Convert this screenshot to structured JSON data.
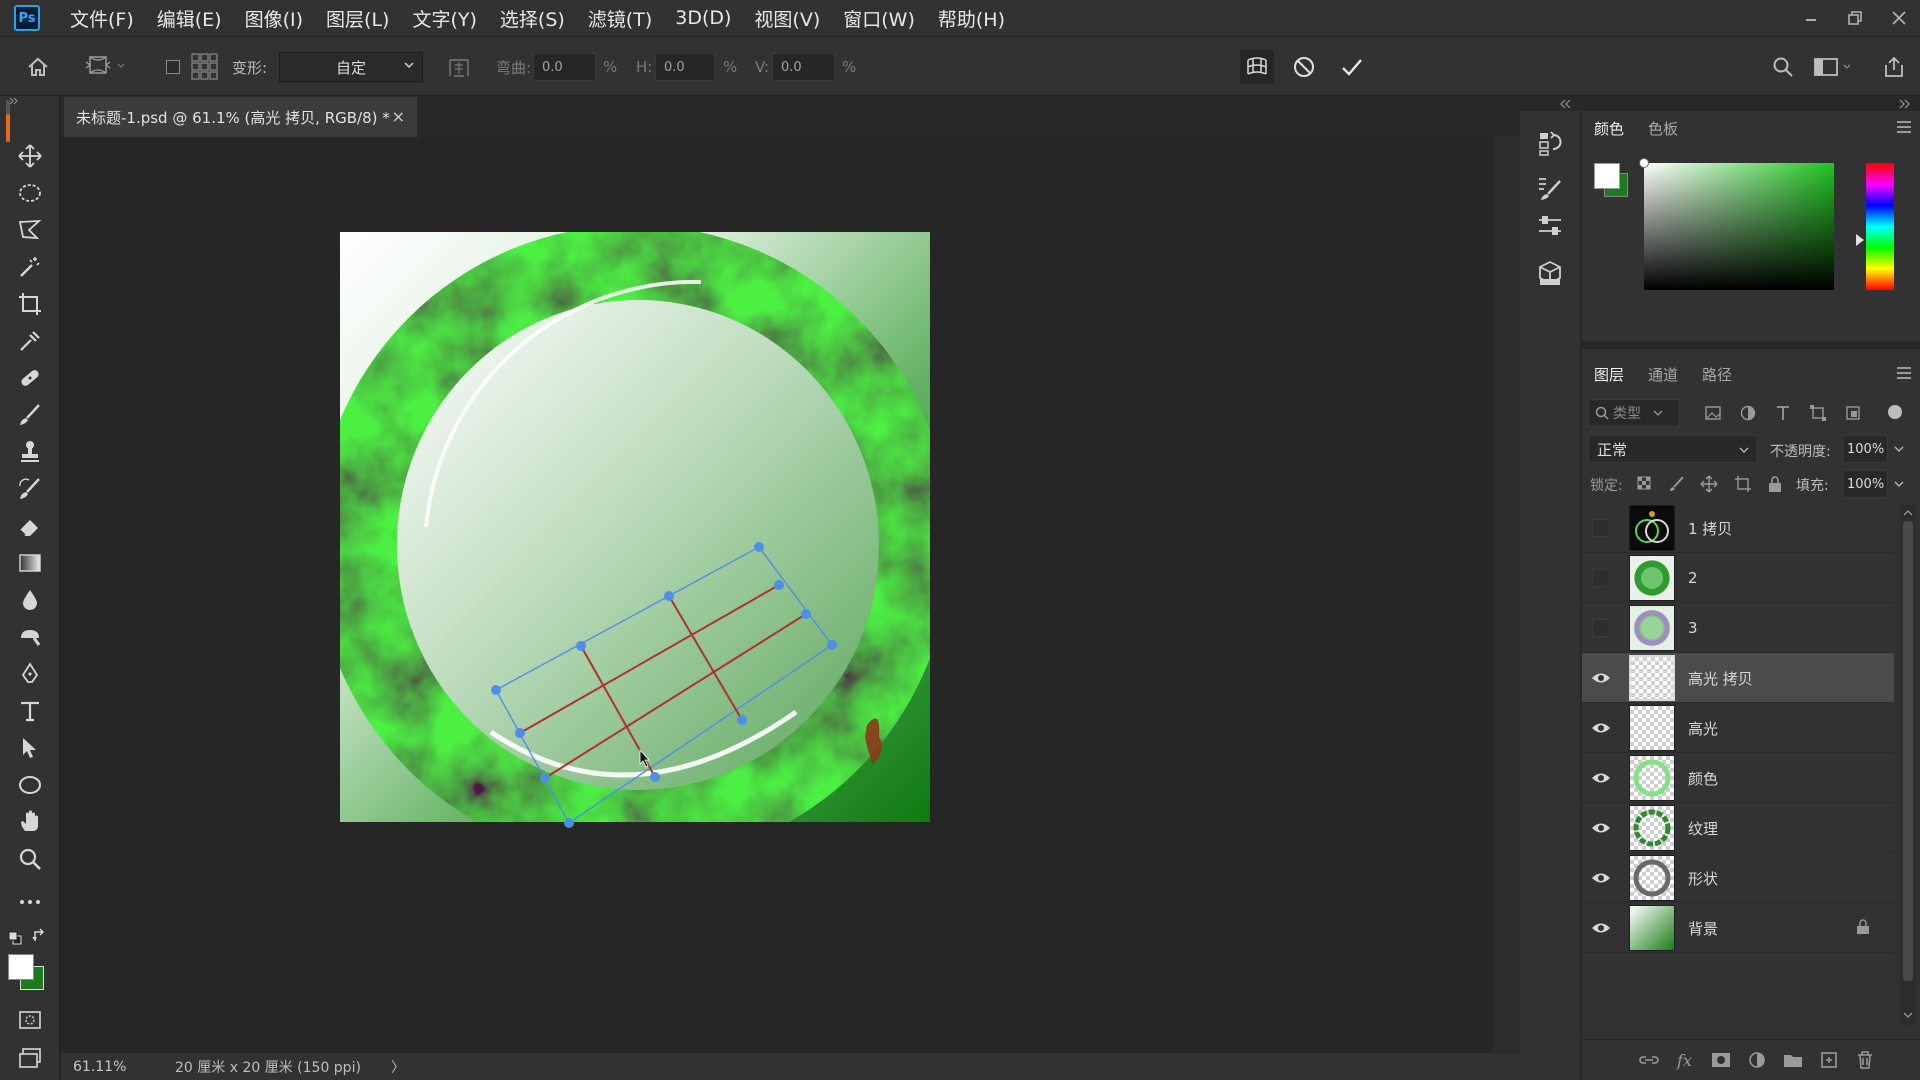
{
  "app": {
    "logo_text": "Ps"
  },
  "menu": [
    "文件(F)",
    "编辑(E)",
    "图像(I)",
    "图层(L)",
    "文字(Y)",
    "选择(S)",
    "滤镜(T)",
    "3D(D)",
    "视图(V)",
    "窗口(W)",
    "帮助(H)"
  ],
  "options": {
    "transform_label": "变形:",
    "transform_value": "自定",
    "bend_label": "弯曲:",
    "bend_value": "0.0",
    "pct": "%",
    "h_label": "H:",
    "h_value": "0.0",
    "v_label": "V:",
    "v_value": "0.0"
  },
  "document": {
    "tab_title": "未标题-1.psd @ 61.1% (高光 拷贝, RGB/8) *",
    "close_glyph": "×",
    "zoom": "61.11%",
    "doc_info": "20 厘米 x 20 厘米 (150 ppi)",
    "info_arrow": "〉"
  },
  "color_panel": {
    "tabs": [
      "颜色",
      "色板"
    ],
    "foreground": "#ffffff",
    "background": "#1f7a1f"
  },
  "layers_panel": {
    "tabs": [
      "图层",
      "通道",
      "路径"
    ],
    "filter_placeholder": "类型",
    "blend_mode": "正常",
    "opacity_label": "不透明度:",
    "opacity_value": "100%",
    "lock_label": "锁定:",
    "fill_label": "填充:",
    "fill_value": "100%",
    "layers": [
      {
        "name": "1 拷贝",
        "visible": false,
        "selected": false,
        "thumb": "dark-rings"
      },
      {
        "name": "2",
        "visible": false,
        "selected": false,
        "thumb": "green-disc"
      },
      {
        "name": "3",
        "visible": false,
        "selected": false,
        "thumb": "purple-ring"
      },
      {
        "name": "高光 拷贝",
        "visible": true,
        "selected": true,
        "thumb": "transparent"
      },
      {
        "name": "高光",
        "visible": true,
        "selected": false,
        "thumb": "transparent"
      },
      {
        "name": "颜色",
        "visible": true,
        "selected": false,
        "thumb": "light-green-ring"
      },
      {
        "name": "纹理",
        "visible": true,
        "selected": false,
        "thumb": "dark-green-ring"
      },
      {
        "name": "形状",
        "visible": true,
        "selected": false,
        "thumb": "gray-ring"
      },
      {
        "name": "背景",
        "visible": true,
        "selected": false,
        "thumb": "background"
      }
    ]
  },
  "canvas": {
    "background_colors": [
      "#ffffff",
      "#0f7a12"
    ],
    "jade_color": "#3aa03a",
    "warp_box_color": "#4f8ee6",
    "warp_grid_color": "#b0302a"
  }
}
